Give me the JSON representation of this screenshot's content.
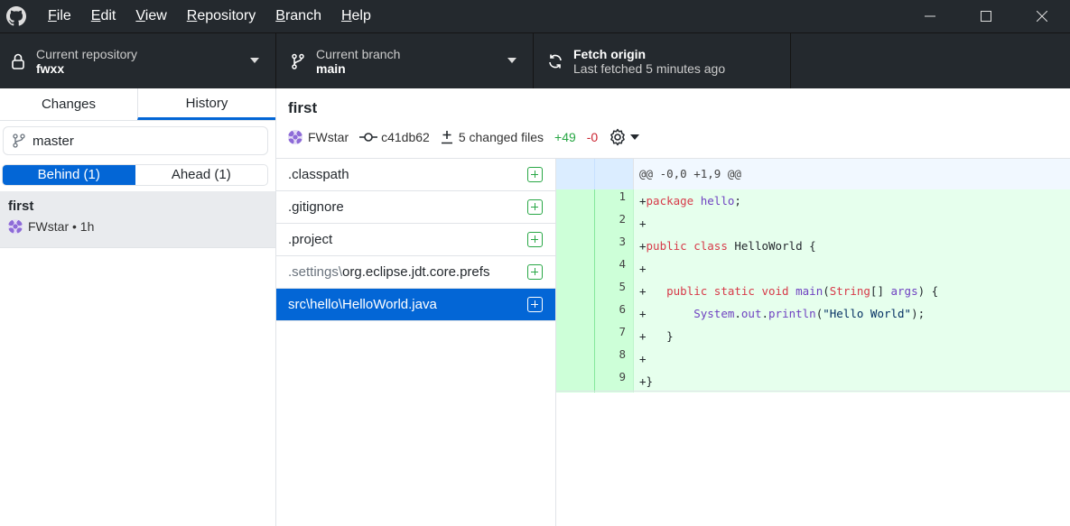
{
  "menu": [
    "File",
    "Edit",
    "View",
    "Repository",
    "Branch",
    "Help"
  ],
  "toolbar": {
    "repo_label": "Current repository",
    "repo_value": "fwxx",
    "branch_label": "Current branch",
    "branch_value": "main",
    "fetch_label": "Fetch origin",
    "fetch_sub": "Last fetched 5 minutes ago"
  },
  "sidebar": {
    "tabs": [
      "Changes",
      "History"
    ],
    "branch_filter": "master",
    "behind": "Behind (1)",
    "ahead": "Ahead (1)",
    "commit": {
      "summary": "first",
      "meta": "FWstar • 1h"
    }
  },
  "commit": {
    "summary": "first",
    "author": "FWstar",
    "sha": "c41db62",
    "changed": "5 changed files",
    "additions": "+49",
    "deletions": "-0"
  },
  "colors": {
    "accent": "#0366d6",
    "added": "#28a745",
    "deleted": "#cb2431",
    "toolbar": "#24292e"
  },
  "files": [
    {
      "dir": "",
      "name": ".classpath"
    },
    {
      "dir": "",
      "name": ".gitignore"
    },
    {
      "dir": "",
      "name": ".project"
    },
    {
      "dir": ".settings\\",
      "name": "org.eclipse.jdt.core.prefs"
    },
    {
      "dir": "src\\hello\\",
      "name": "HelloWorld.java",
      "selected": true
    }
  ],
  "diff": {
    "hunk": "@@ -0,0 +1,9 @@",
    "lines": [
      {
        "n": "1",
        "t": [
          [
            "+",
            "p"
          ],
          [
            "package",
            "k"
          ],
          [
            " ",
            "p"
          ],
          [
            "hello",
            "n"
          ],
          [
            ";",
            "p"
          ]
        ]
      },
      {
        "n": "2",
        "t": [
          [
            "+",
            "p"
          ]
        ]
      },
      {
        "n": "3",
        "t": [
          [
            "+",
            "p"
          ],
          [
            "public",
            "k"
          ],
          [
            " ",
            "p"
          ],
          [
            "class",
            "k"
          ],
          [
            " HelloWorld {",
            "p"
          ]
        ]
      },
      {
        "n": "4",
        "t": [
          [
            "+",
            "p"
          ]
        ]
      },
      {
        "n": "5",
        "t": [
          [
            "+   ",
            "p"
          ],
          [
            "public",
            "k"
          ],
          [
            " ",
            "p"
          ],
          [
            "static",
            "k"
          ],
          [
            " ",
            "p"
          ],
          [
            "void",
            "k"
          ],
          [
            " ",
            "p"
          ],
          [
            "main",
            "n"
          ],
          [
            "(",
            "p"
          ],
          [
            "String",
            "k"
          ],
          [
            "[] ",
            "p"
          ],
          [
            "args",
            "n"
          ],
          [
            ") {",
            "p"
          ]
        ]
      },
      {
        "n": "6",
        "t": [
          [
            "+       ",
            "p"
          ],
          [
            "System",
            "n"
          ],
          [
            ".",
            "p"
          ],
          [
            "out",
            "n"
          ],
          [
            ".",
            "p"
          ],
          [
            "println",
            "n"
          ],
          [
            "(",
            "p"
          ],
          [
            "\"Hello World\"",
            "str"
          ],
          [
            ");",
            "p"
          ]
        ]
      },
      {
        "n": "7",
        "t": [
          [
            "+   }",
            "p"
          ]
        ]
      },
      {
        "n": "8",
        "t": [
          [
            "+",
            "p"
          ]
        ]
      },
      {
        "n": "9",
        "t": [
          [
            "+}",
            "p"
          ]
        ]
      }
    ]
  }
}
